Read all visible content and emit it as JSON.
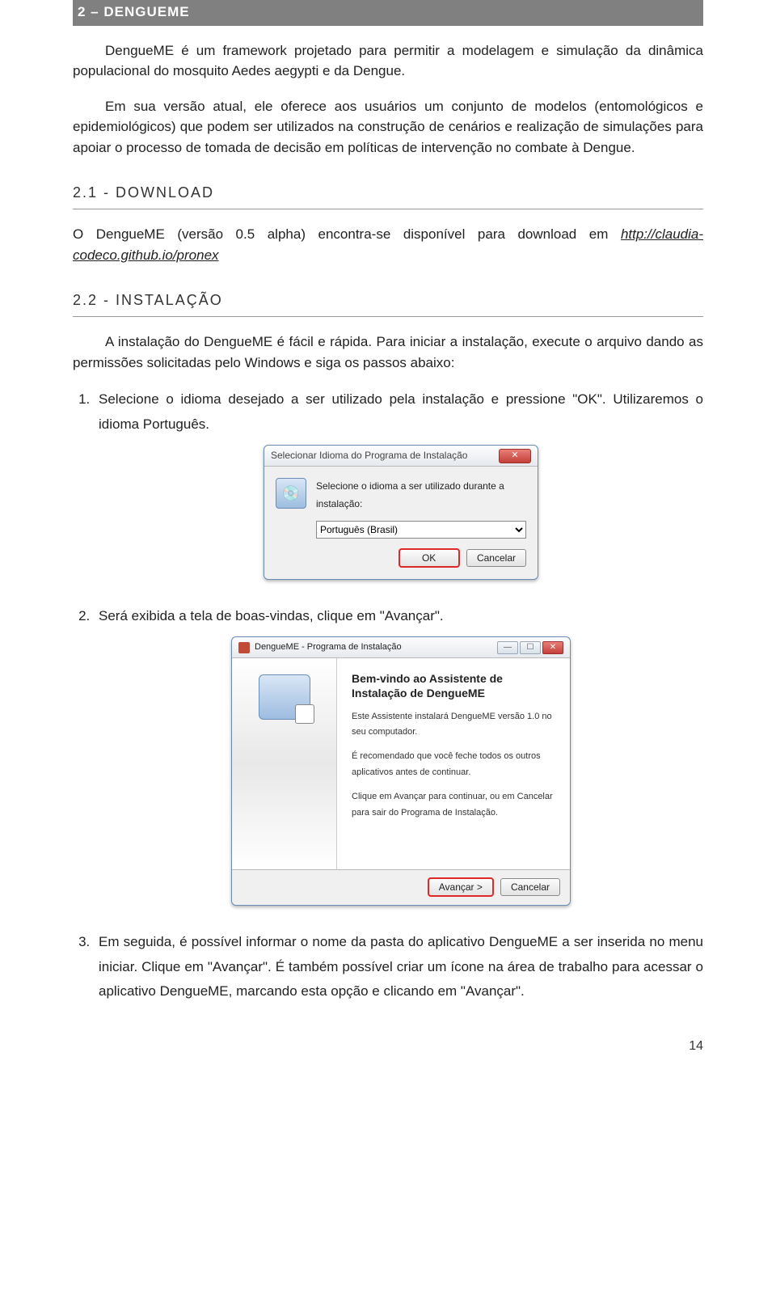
{
  "section_title": "2 – DENGUEME",
  "intro_p1": "DengueME é um framework projetado para permitir a modelagem e simulação da dinâmica populacional do mosquito Aedes aegypti e da Dengue.",
  "intro_p2": "Em sua versão atual, ele oferece aos usuários um conjunto de modelos (entomológicos e epidemiológicos) que podem ser utilizados na construção de cenários e realização de simulações para apoiar o processo de tomada de decisão em políticas de intervenção no combate à Dengue.",
  "sub1_title": "2.1 - DOWNLOAD",
  "sub1_text_a": "O DengueME (versão 0.5 alpha) encontra-se disponível para download em ",
  "sub1_link": "http://claudia-codeco.github.io/pronex",
  "sub2_title": "2.2 - INSTALAÇÃO",
  "sub2_text": "A instalação do DengueME é fácil e rápida. Para iniciar a instalação, execute o arquivo dando as permissões solicitadas pelo Windows e siga os passos abaixo:",
  "steps": {
    "s1": "Selecione o idioma desejado a ser utilizado pela instalação e pressione \"OK\". Utilizaremos o idioma Português.",
    "s2": "Será exibida a tela de boas-vindas, clique em \"Avançar\".",
    "s3": "Em seguida, é possível informar o nome da pasta do aplicativo DengueME a ser inserida no menu iniciar. Clique em \"Avançar\". É também possível criar um ícone na área de trabalho para acessar o aplicativo DengueME, marcando esta opção e clicando em \"Avançar\"."
  },
  "dlg1": {
    "title": "Selecionar Idioma do Programa de Instalação",
    "msg": "Selecione o idioma a ser utilizado durante a instalação:",
    "option": "Português (Brasil)",
    "ok": "OK",
    "cancel": "Cancelar",
    "close": "✕"
  },
  "dlg2": {
    "title": "DengueME - Programa de Instalação",
    "heading": "Bem-vindo ao Assistente de Instalação de DengueME",
    "p1": "Este Assistente instalará DengueME versão 1.0 no seu computador.",
    "p2": "É recomendado que você feche todos os outros aplicativos antes de continuar.",
    "p3": "Clique em Avançar para continuar, ou em Cancelar para sair do Programa de Instalação.",
    "next": "Avançar >",
    "cancel": "Cancelar",
    "min": "—",
    "max": "☐",
    "close": "✕"
  },
  "page_number": "14"
}
